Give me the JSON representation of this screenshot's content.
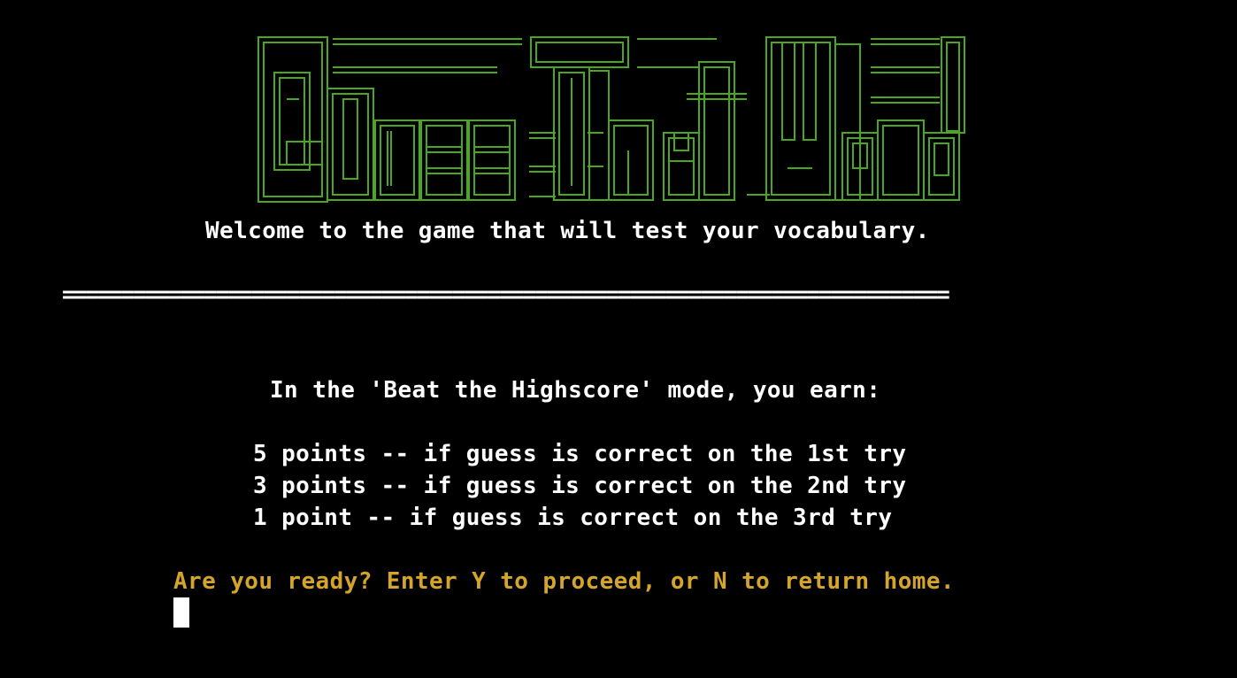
{
  "logo": {
    "text": "Guess That Word",
    "color": "#4aa81c"
  },
  "welcome": "Welcome to the game that will test your vocabulary.",
  "divider": "===========================================================================",
  "mode_intro": "In the 'Beat the Highscore' mode, you earn:",
  "scoring": [
    "5 points -- if guess is correct on the 1st try",
    "3 points -- if guess is correct on the 2nd try",
    "1 point -- if guess is correct on the 3rd try"
  ],
  "prompt": "Are you ready? Enter Y to proceed, or N to return home.",
  "colors": {
    "background": "#000000",
    "text": "#ffffff",
    "prompt": "#d4a52a",
    "logo": "#4aa81c"
  }
}
